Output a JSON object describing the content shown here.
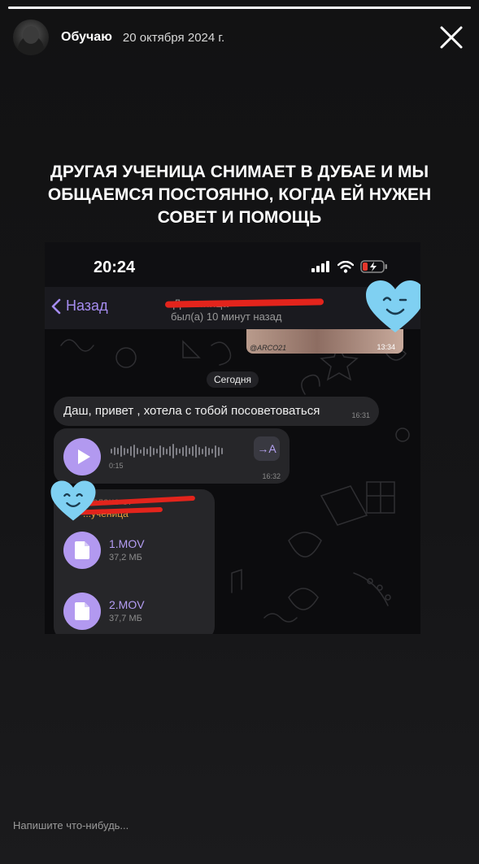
{
  "story": {
    "progress": 1.0,
    "author": "Обучаю",
    "date": "20 октября 2024 г.",
    "caption": "Другая ученица снимает в Дубае и мы общаемся постоянно, когда ей нужен совет и помощь",
    "reply_placeholder": "Напишите что-нибудь..."
  },
  "phone": {
    "status_time": "20:24",
    "back_label": "Назад",
    "contact_name": "Д... ...ница",
    "presence": "был(а) 10 минут назад"
  },
  "chat": {
    "photo_watermark": "@ARCO21",
    "photo_time": "13:34",
    "date_divider": "Сегодня",
    "message_text": "Даш, привет , хотела с тобой посоветоваться",
    "message_time": "16:31",
    "voice_duration": "0:15",
    "voice_time": "16:32",
    "transcribe_label": "→A",
    "forward_label": "...слано от",
    "forward_name": "...ученица",
    "files": [
      {
        "name": "1.MOV",
        "size": "37,2 МБ"
      },
      {
        "name": "2.MOV",
        "size": "37,7 МБ"
      }
    ]
  },
  "colors": {
    "accent": "#a58cf0",
    "file_icon": "#b299f0",
    "bubble": "#262629",
    "sticker_heart": "#7fd0f2",
    "redaction": "#e3241c"
  },
  "icons": [
    "close-icon",
    "back-chevron-icon",
    "signal-icon",
    "wifi-icon",
    "battery-icon",
    "play-icon",
    "file-icon",
    "heart-sticker-icon"
  ]
}
